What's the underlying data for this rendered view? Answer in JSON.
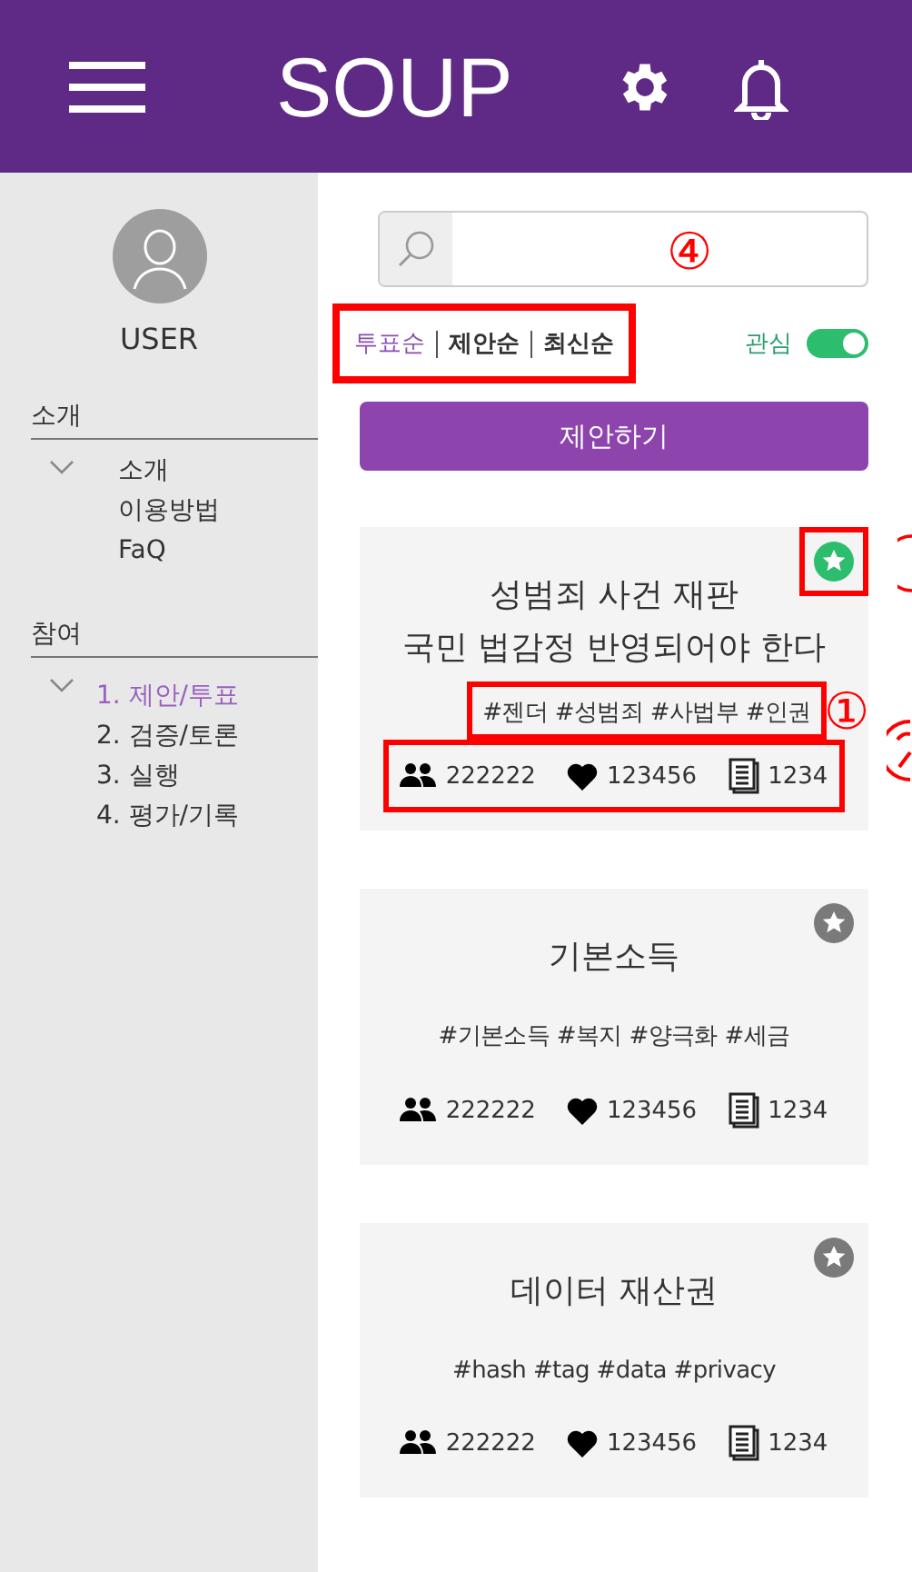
{
  "header": {
    "logo": "SOUP"
  },
  "sidebar": {
    "user": "USER",
    "sections": [
      {
        "title": "소개",
        "expanded": true,
        "items": [
          {
            "label": "소개",
            "selected": false
          },
          {
            "label": "이용방법",
            "selected": false
          },
          {
            "label": "FaQ",
            "selected": false
          }
        ]
      },
      {
        "title": "참여",
        "expanded": true,
        "items": [
          {
            "label": "1. 제안/투표",
            "selected": true
          },
          {
            "label": "2. 검증/토론",
            "selected": false
          },
          {
            "label": "3. 실행",
            "selected": false
          },
          {
            "label": "4. 평가/기록",
            "selected": false
          }
        ]
      }
    ]
  },
  "sort_tabs": {
    "outlined": true,
    "marker": "④",
    "tabs": [
      {
        "label": "투표순",
        "selected": true
      },
      {
        "label": "제안순",
        "selected": false
      },
      {
        "label": "최신순",
        "selected": false
      }
    ]
  },
  "interest_toggle": {
    "label": "관심",
    "on": true
  },
  "propose_button": "제안하기",
  "cards": [
    {
      "title_lines": [
        "성범죄 사건 재판",
        "국민 법감정 반영되어야 한다"
      ],
      "tags": "#젠더 #성범죄 #사법부 #인권",
      "favorite": true,
      "annotated": true,
      "tags_marker": "①",
      "participants": "222222",
      "likes": "123456",
      "comments": "1234"
    },
    {
      "title_lines": [
        "기본소득"
      ],
      "tags": "#기본소득 #복지 #양극화 #세금",
      "favorite": false,
      "annotated": false,
      "participants": "222222",
      "likes": "123456",
      "comments": "1234"
    },
    {
      "title_lines": [
        "데이터 재산권"
      ],
      "tags": "#hash #tag #data #privacy",
      "favorite": false,
      "annotated": false,
      "participants": "222222",
      "likes": "123456",
      "comments": "1234"
    }
  ]
}
